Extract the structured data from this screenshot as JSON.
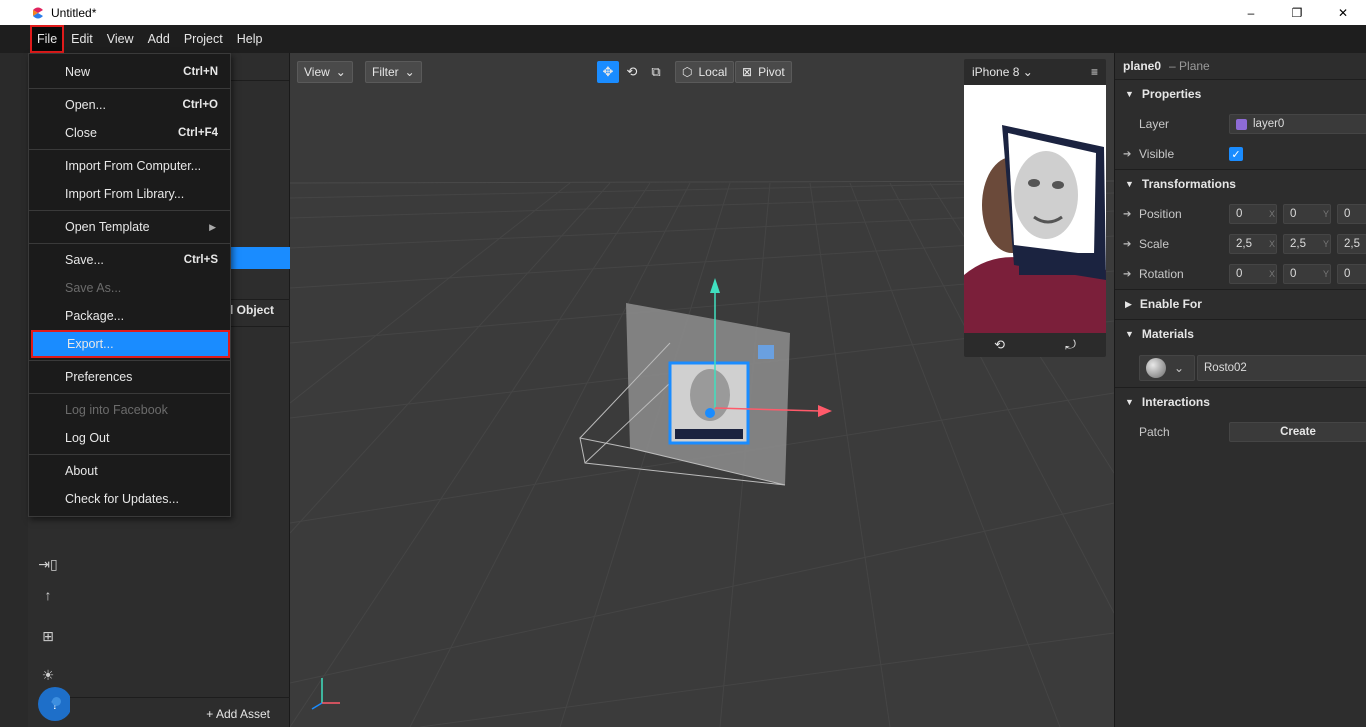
{
  "window": {
    "title": "Untitled*",
    "minimize": "–",
    "restore": "❐",
    "close": "✕"
  },
  "menubar": [
    "File",
    "Edit",
    "View",
    "Add",
    "Project",
    "Help"
  ],
  "file_menu": {
    "new": "New",
    "new_sc": "Ctrl+N",
    "open": "Open...",
    "open_sc": "Ctrl+O",
    "close": "Close",
    "close_sc": "Ctrl+F4",
    "import_computer": "Import From Computer...",
    "import_library": "Import From Library...",
    "open_template": "Open Template",
    "save": "Save...",
    "save_sc": "Ctrl+S",
    "save_as": "Save As...",
    "package": "Package...",
    "export": "Export...",
    "preferences": "Preferences",
    "log_fb": "Log into Facebook",
    "log_out": "Log Out",
    "about": "About",
    "check_updates": "Check for Updates..."
  },
  "left_panel": {
    "add_object": "l Object",
    "add_asset": "+ Add Asset"
  },
  "viewport": {
    "view": "View",
    "filter": "Filter",
    "local": "Local",
    "pivot": "Pivot"
  },
  "simulator": {
    "device": "iPhone 8"
  },
  "inspector": {
    "object_name": "plane0",
    "object_type": "– Plane",
    "properties": "Properties",
    "layer_label": "Layer",
    "layer_value": "layer0",
    "layer_color": "#8e6bd6",
    "visible_label": "Visible",
    "transformations": "Transformations",
    "position_label": "Position",
    "position": [
      "0",
      "0",
      "0"
    ],
    "scale_label": "Scale",
    "scale": [
      "2,5",
      "2,5",
      "2,5"
    ],
    "rotation_label": "Rotation",
    "rotation": [
      "0",
      "0",
      "0"
    ],
    "axis": [
      "X",
      "Y"
    ],
    "enable_for": "Enable For",
    "materials": "Materials",
    "material_value": "Rosto02",
    "interactions": "Interactions",
    "patch_label": "Patch",
    "create_button": "Create"
  },
  "colors": {
    "accent": "#1a8cff",
    "highlight_border": "#e01b1b"
  }
}
